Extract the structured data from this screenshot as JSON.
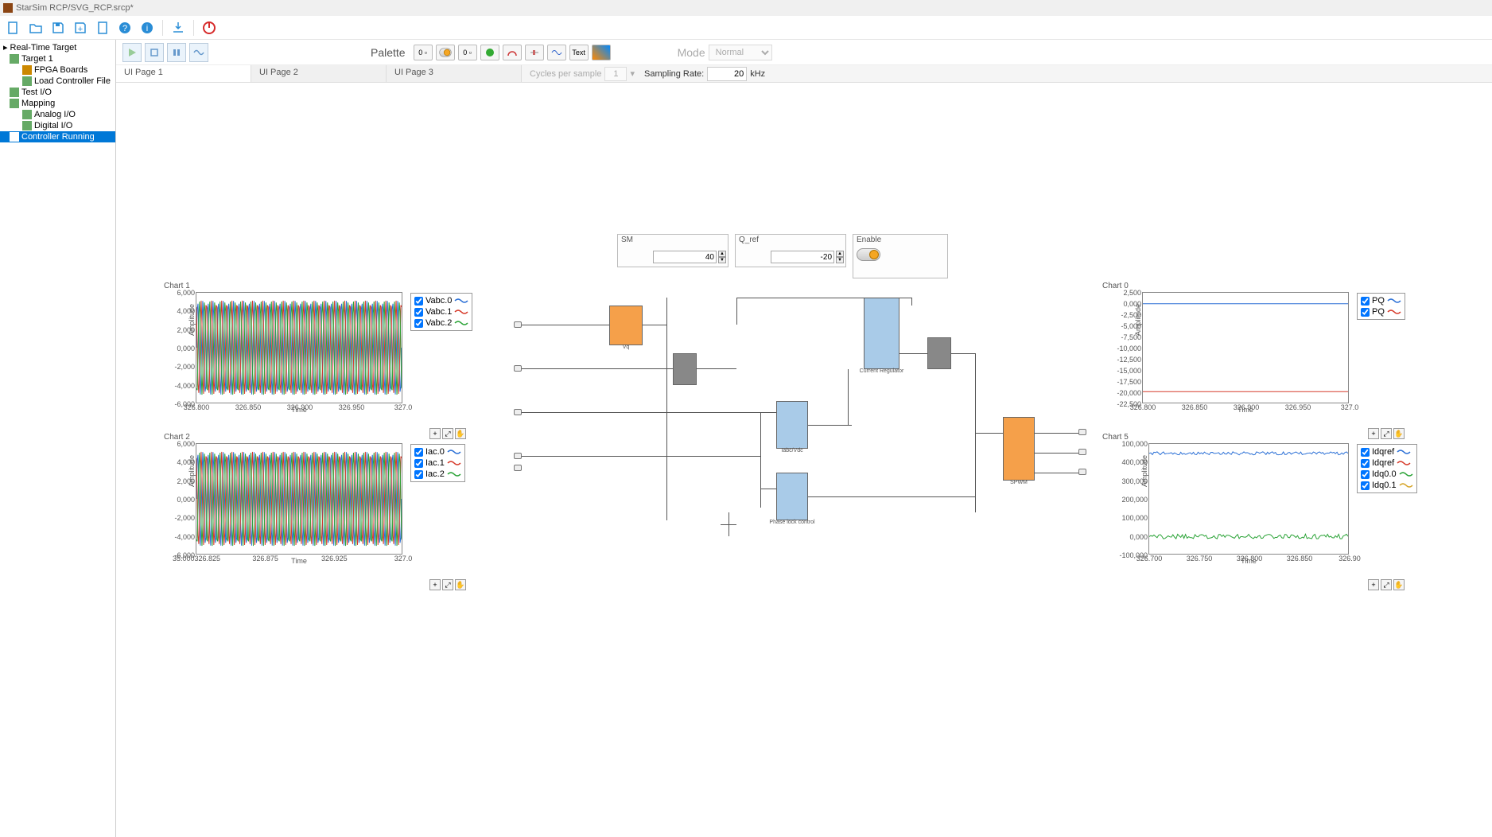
{
  "window": {
    "title": "StarSim RCP/SVG_RCP.srcp*"
  },
  "toolbar": {
    "icons": [
      "new",
      "open",
      "save",
      "save-as",
      "blank",
      "help",
      "info",
      "sep",
      "download",
      "sep",
      "power"
    ]
  },
  "tree": {
    "root": "Real-Time Target",
    "items": [
      {
        "label": "Target 1",
        "level": 1,
        "icon": "target"
      },
      {
        "label": "FPGA Boards",
        "level": 2,
        "icon": "fpga"
      },
      {
        "label": "Load Controller File",
        "level": 2,
        "icon": "load"
      },
      {
        "label": "Test I/O",
        "level": 1,
        "icon": "test"
      },
      {
        "label": "Mapping",
        "level": 1,
        "icon": "map"
      },
      {
        "label": "Analog I/O",
        "level": 2,
        "icon": "analog"
      },
      {
        "label": "Digital I/O",
        "level": 2,
        "icon": "digital"
      },
      {
        "label": "Controller Running",
        "level": 1,
        "icon": "run",
        "selected": true
      }
    ]
  },
  "palette": {
    "label": "Palette",
    "items": [
      "num-display",
      "toggle",
      "num-input",
      "led",
      "dial",
      "slider",
      "chart",
      "text",
      "image"
    ],
    "text_label": "Text"
  },
  "mode": {
    "label": "Mode",
    "value": "Normal"
  },
  "tabs": [
    "UI Page 1",
    "UI Page 2",
    "UI Page 3"
  ],
  "active_tab": 0,
  "cycles": {
    "label": "Cycles per sample",
    "value": "1"
  },
  "rate": {
    "label": "Sampling Rate:",
    "value": "20",
    "unit": "kHz"
  },
  "inputs": {
    "sm": {
      "label": "SM",
      "value": "40"
    },
    "qref": {
      "label": "Q_ref",
      "value": "-20"
    },
    "enable": {
      "label": "Enable",
      "on": true
    }
  },
  "blocks": {
    "b1": {
      "label": "Vq"
    },
    "b2": {
      "label": ""
    },
    "b3": {
      "label": "Current Regulator"
    },
    "b4": {
      "label": ""
    },
    "b5": {
      "label": "Iabc/Vdc"
    },
    "b6": {
      "label": "Phase lock control"
    },
    "b7": {
      "label": "SPWM"
    }
  },
  "charts": {
    "c1": {
      "title": "Chart 1",
      "ylabel": "Amplitude",
      "xlabel": "Time",
      "yticks": [
        "6,000",
        "4,000",
        "2,000",
        "0,000",
        "-2,000",
        "-4,000",
        "-6,000"
      ],
      "xticks": [
        "326.800",
        "326.850",
        "326.900",
        "326.950",
        "327.0"
      ],
      "legend": [
        {
          "name": "Vabc.0",
          "color": "#2a6fd6"
        },
        {
          "name": "Vabc.1",
          "color": "#d63a2a"
        },
        {
          "name": "Vabc.2",
          "color": "#2aa336"
        }
      ]
    },
    "c2": {
      "title": "Chart 2",
      "ylabel": "Amplitude",
      "xlabel": "Time",
      "yticks": [
        "6,000",
        "4,000",
        "2,000",
        "0,000",
        "-2,000",
        "-4,000",
        "-6,000"
      ],
      "xticks": [
        "35.000326.825",
        "326.875",
        "326.925",
        "327.0"
      ],
      "legend": [
        {
          "name": "Iac.0",
          "color": "#2a6fd6"
        },
        {
          "name": "Iac.1",
          "color": "#d63a2a"
        },
        {
          "name": "Iac.2",
          "color": "#2aa336"
        }
      ]
    },
    "c0": {
      "title": "Chart 0",
      "ylabel": "Amplitude",
      "xlabel": "Time",
      "yticks": [
        "2,500",
        "0,000",
        "-2,500",
        "-5,000",
        "-7,500",
        "-10,000",
        "-12,500",
        "-15,000",
        "-17,500",
        "-20,000",
        "-22,500"
      ],
      "xticks": [
        "326.800",
        "326.850",
        "326.900",
        "326.950",
        "327.0"
      ],
      "legend": [
        {
          "name": "PQ",
          "color": "#2a6fd6"
        },
        {
          "name": "PQ",
          "color": "#d63a2a"
        }
      ]
    },
    "c5": {
      "title": "Chart 5",
      "ylabel": "Amplitude",
      "xlabel": "Time",
      "yticks": [
        "100,000",
        "400,000",
        "300,000",
        "200,000",
        "100,000",
        "0,000",
        "-100,000"
      ],
      "xticks": [
        "326.700",
        "326.750",
        "326.800",
        "326.850",
        "326.90"
      ],
      "legend": [
        {
          "name": "Idqref",
          "color": "#2a6fd6"
        },
        {
          "name": "Idqref",
          "color": "#d63a2a"
        },
        {
          "name": "Idq0.0",
          "color": "#2aa336"
        },
        {
          "name": "Idq0.1",
          "color": "#d6a52a"
        }
      ]
    }
  },
  "chart_data": [
    {
      "id": "c1",
      "type": "line",
      "title": "Chart 1",
      "xlabel": "Time",
      "ylabel": "Amplitude",
      "ylim": [
        -6000,
        6000
      ],
      "xlim": [
        326.8,
        327.0
      ],
      "series": [
        {
          "name": "Vabc.0",
          "color": "#2a6fd6",
          "desc": "sine ~5500 amp, ~50 cycles in window"
        },
        {
          "name": "Vabc.1",
          "color": "#d63a2a",
          "desc": "sine ~5500 amp, 120° phase"
        },
        {
          "name": "Vabc.2",
          "color": "#2aa336",
          "desc": "sine ~5500 amp, 240° phase"
        }
      ]
    },
    {
      "id": "c2",
      "type": "line",
      "title": "Chart 2",
      "xlabel": "Time",
      "ylabel": "Amplitude",
      "ylim": [
        -6000,
        6000
      ],
      "xlim": [
        326.8,
        327.0
      ],
      "series": [
        {
          "name": "Iac.0",
          "color": "#2a6fd6",
          "desc": "sine ~5500 amp"
        },
        {
          "name": "Iac.1",
          "color": "#d63a2a",
          "desc": "sine ~5500 amp 120°"
        },
        {
          "name": "Iac.2",
          "color": "#2aa336",
          "desc": "sine ~5500 amp 240°"
        }
      ]
    },
    {
      "id": "c0",
      "type": "line",
      "title": "Chart 0",
      "xlabel": "Time",
      "ylabel": "Amplitude",
      "ylim": [
        -22500,
        2500
      ],
      "xlim": [
        326.8,
        327.0
      ],
      "series": [
        {
          "name": "PQ",
          "color": "#2a6fd6",
          "values_approx": "flat near 0"
        },
        {
          "name": "PQ",
          "color": "#d63a2a",
          "values_approx": "flat near -20000"
        }
      ]
    },
    {
      "id": "c5",
      "type": "line",
      "title": "Chart 5",
      "xlabel": "Time",
      "ylabel": "Amplitude",
      "ylim": [
        -100000,
        500000
      ],
      "xlim": [
        326.7,
        326.9
      ],
      "series": [
        {
          "name": "Idqref",
          "color": "#2a6fd6",
          "values_approx": "noisy flat ~480000"
        },
        {
          "name": "Idqref",
          "color": "#d63a2a",
          "values_approx": "flat ~480000"
        },
        {
          "name": "Idq0.0",
          "color": "#2aa336",
          "values_approx": "noisy flat ~0"
        },
        {
          "name": "Idq0.1",
          "color": "#d6a52a",
          "values_approx": "flat ~0"
        }
      ]
    }
  ]
}
